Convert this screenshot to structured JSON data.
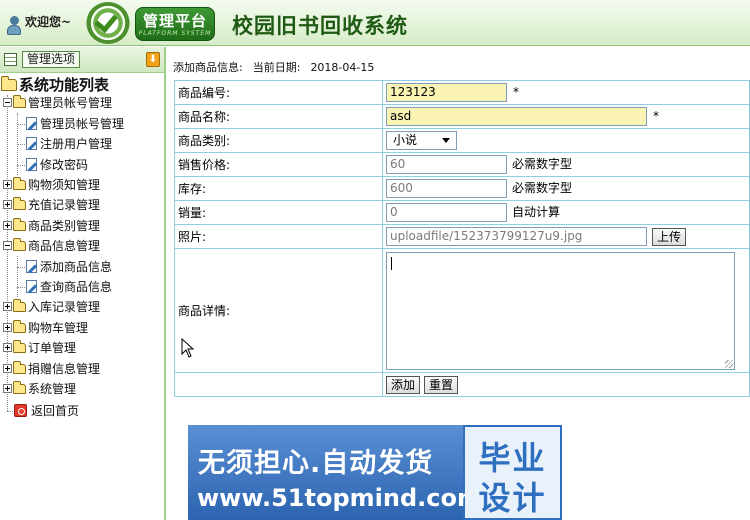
{
  "header": {
    "welcome": "欢迎您~",
    "logo_cn": "管理平台",
    "logo_en": "PLATFORM SYSTEM",
    "title": "校园旧书回收系统"
  },
  "sidebar": {
    "tab_label": "管理选项",
    "root_label": "系统功能列表",
    "groups": [
      {
        "label": "管理员帐号管理",
        "expanded": true,
        "items": [
          "管理员帐号管理",
          "注册用户管理",
          "修改密码"
        ]
      },
      {
        "label": "购物须知管理",
        "expanded": false
      },
      {
        "label": "充值记录管理",
        "expanded": false
      },
      {
        "label": "商品类别管理",
        "expanded": false
      },
      {
        "label": "商品信息管理",
        "expanded": true,
        "items": [
          "添加商品信息",
          "查询商品信息"
        ]
      },
      {
        "label": "入库记录管理",
        "expanded": false
      },
      {
        "label": "购物车管理",
        "expanded": false
      },
      {
        "label": "订单管理",
        "expanded": false
      },
      {
        "label": "捐赠信息管理",
        "expanded": false
      },
      {
        "label": "系统管理",
        "expanded": false
      }
    ],
    "home_label": "返回首页"
  },
  "page": {
    "info_label": "添加商品信息:",
    "date_label": "当前日期:",
    "date_value": "2018-04-15"
  },
  "form": {
    "code_label": "商品编号:",
    "code_value": "123123",
    "name_label": "商品名称:",
    "name_value": "asd",
    "required_mark": "*",
    "category_label": "商品类别:",
    "category_value": "小说",
    "price_label": "销售价格:",
    "price_value": "60",
    "price_hint": "必需数字型",
    "stock_label": "库存:",
    "stock_value": "600",
    "stock_hint": "必需数字型",
    "sales_label": "销量:",
    "sales_value": "0",
    "sales_hint": "自动计算",
    "photo_label": "照片:",
    "photo_value": "uploadfile/152373799127u9.jpg",
    "upload_label": "上传",
    "detail_label": "商品详情:",
    "detail_value": "",
    "submit_label": "添加",
    "reset_label": "重置"
  },
  "banner": {
    "line1": "无须担心.自动发货",
    "line2": "www.51topmind.com",
    "right_top": "毕业",
    "right_bottom": "设计"
  }
}
